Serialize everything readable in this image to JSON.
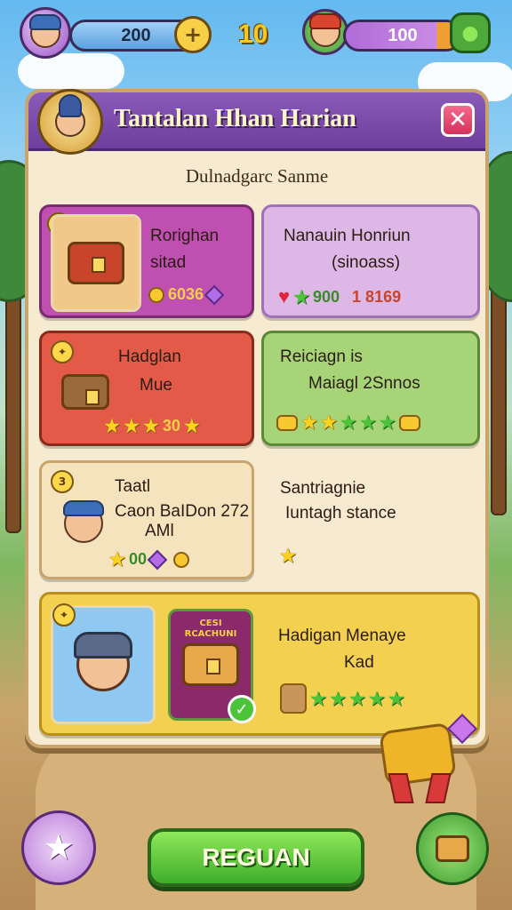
{
  "hud": {
    "player_value": "200",
    "level": "10",
    "opponent_value": "100"
  },
  "panel": {
    "title": "Tantalan Hhan Harian",
    "subtitle": "Dulnadgarc Sanme",
    "close_label": "✕"
  },
  "cards": [
    {
      "line1": "Rorighan",
      "line2": "sitad",
      "stat": "6036"
    },
    {
      "line1": "Nanauin Honriun",
      "line2": "(sinoass)",
      "stat_a": "900",
      "stat_b": "1 8169"
    },
    {
      "line1": "Hadglan",
      "line2": "Mue",
      "stat": "30"
    },
    {
      "line1": "Reiciagn is",
      "line2": "Maiagl 2Snnos"
    },
    {
      "line1": "Taatl",
      "line2": "Caon BaIDon 272",
      "line3": "AMl",
      "stat": "00"
    },
    {
      "line1": "Santriagnie",
      "line2": "Iuntagh stance"
    },
    {
      "line1": "Hadigan Menaye",
      "line2": "Kad",
      "chest_label": "CESI RCACHUNI"
    }
  ],
  "cta": {
    "label": "REGUAN"
  },
  "icons": {
    "coin": "coin-icon",
    "gem": "gem-icon",
    "star": "star-icon",
    "heart": "heart-icon",
    "close": "close-icon",
    "chest": "treasure-chest-icon",
    "check": "checkmark-icon"
  },
  "colors": {
    "header": "#7a4aa8",
    "card_magenta": "#c04fb2",
    "card_lilac": "#ddb8e6",
    "card_red": "#e45a48",
    "card_green": "#a8d478",
    "card_cream": "#f5e3bd",
    "card_yellow": "#f4d050",
    "cta_green": "#5cc43a"
  }
}
